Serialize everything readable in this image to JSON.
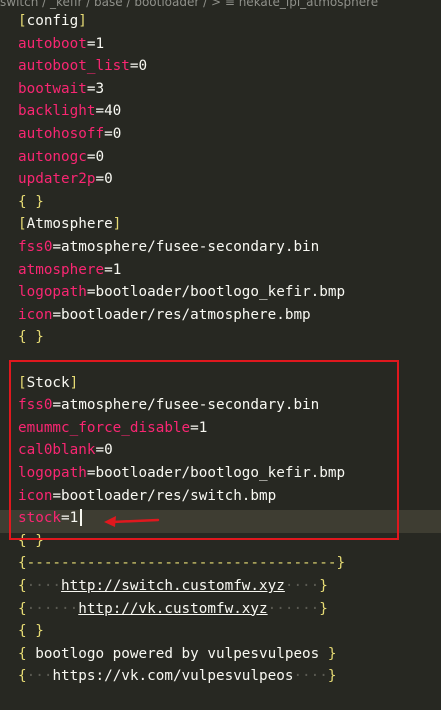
{
  "breadcrumb": "switch / _kefir / base / bootloader / > ≡ hekate_ipl_atmosphere",
  "editor": {
    "lines": [
      {
        "type": "section",
        "name": "config"
      },
      {
        "type": "kv",
        "key": "autoboot",
        "value": "1"
      },
      {
        "type": "kv",
        "key": "autoboot_list",
        "value": "0"
      },
      {
        "type": "kv",
        "key": "bootwait",
        "value": "3"
      },
      {
        "type": "kv",
        "key": "backlight",
        "value": "40"
      },
      {
        "type": "kv",
        "key": "autohosoff",
        "value": "0"
      },
      {
        "type": "kv",
        "key": "autonogc",
        "value": "0"
      },
      {
        "type": "kv",
        "key": "updater2p",
        "value": "0"
      },
      {
        "type": "braces",
        "text": "{ }"
      },
      {
        "type": "section",
        "name": "Atmosphere"
      },
      {
        "type": "kv",
        "key": "fss0",
        "value": "atmosphere/fusee-secondary.bin"
      },
      {
        "type": "kv",
        "key": "atmosphere",
        "value": "1"
      },
      {
        "type": "kv",
        "key": "logopath",
        "value": "bootloader/bootlogo_kefir.bmp"
      },
      {
        "type": "kv",
        "key": "icon",
        "value": "bootloader/res/atmosphere.bmp"
      },
      {
        "type": "braces",
        "text": "{ }"
      },
      {
        "type": "blank",
        "text": ""
      },
      {
        "type": "section",
        "name": "Stock"
      },
      {
        "type": "kv",
        "key": "fss0",
        "value": "atmosphere/fusee-secondary.bin"
      },
      {
        "type": "kv",
        "key": "emummc_force_disable",
        "value": "1"
      },
      {
        "type": "kv",
        "key": "cal0blank",
        "value": "0"
      },
      {
        "type": "kv",
        "key": "logopath",
        "value": "bootloader/bootlogo_kefir.bmp"
      },
      {
        "type": "kv",
        "key": "icon",
        "value": "bootloader/res/switch.bmp"
      },
      {
        "type": "kv",
        "key": "stock",
        "value": "1",
        "cursor": true
      },
      {
        "type": "braces",
        "text": "{ }"
      },
      {
        "type": "comment",
        "open": "{",
        "body": "------------------------------------",
        "close": "}"
      },
      {
        "type": "comment",
        "open": "{",
        "pad_left": "    ",
        "link": "http://switch.customfw.xyz",
        "pad_right": "    ",
        "close": "}"
      },
      {
        "type": "comment",
        "open": "{",
        "pad_left": "      ",
        "link": "http://vk.customfw.xyz",
        "pad_right": "      ",
        "close": "}"
      },
      {
        "type": "braces",
        "text": "{ }"
      },
      {
        "type": "plain",
        "text": "{ bootlogo powered by vulpesvulpeos }"
      },
      {
        "type": "comment",
        "open": "{",
        "pad_left": "   ",
        "text": "https://vk.com/vulpesvulpeos",
        "pad_right": "    ",
        "close": "}"
      }
    ]
  },
  "colors": {
    "background": "#272822",
    "key": "#f92672",
    "bracket": "#e6db74",
    "annotation": "#e0181e"
  }
}
